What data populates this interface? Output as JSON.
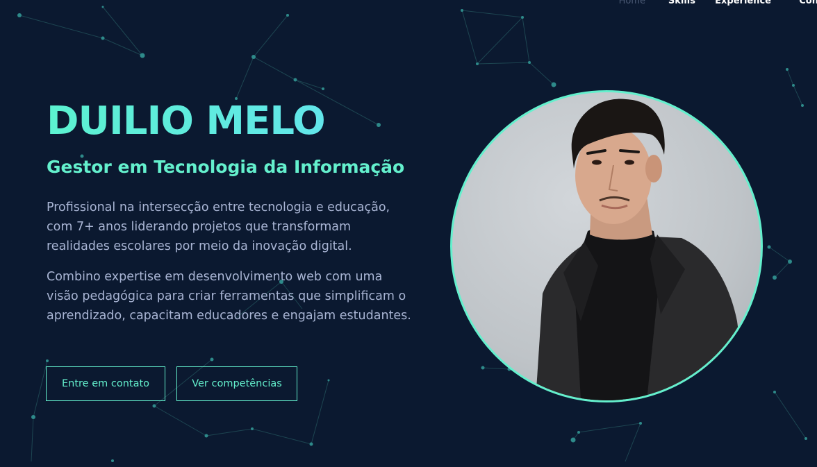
{
  "nav": {
    "items": [
      "Home",
      "Skills",
      "Experience",
      "Con"
    ]
  },
  "hero": {
    "name": "DUILIO MELO",
    "role": "Gestor em Tecnologia da Informação",
    "paragraph1": "Profissional na intersecção entre tecnologia e educação, com 7+ anos liderando projetos que transformam realidades escolares por meio da inovação digital.",
    "paragraph2": "Combino expertise em desenvolvimento web com uma visão pedagógica para criar ferramentas que simplificam o aprendizado, capacitam educadores e engajam estudantes.",
    "contact_button": "Entre em contato",
    "skills_button": "Ver competências"
  },
  "colors": {
    "background": "#0b1930",
    "accent": "#64f0cd",
    "text_muted": "#a9b5d4"
  }
}
